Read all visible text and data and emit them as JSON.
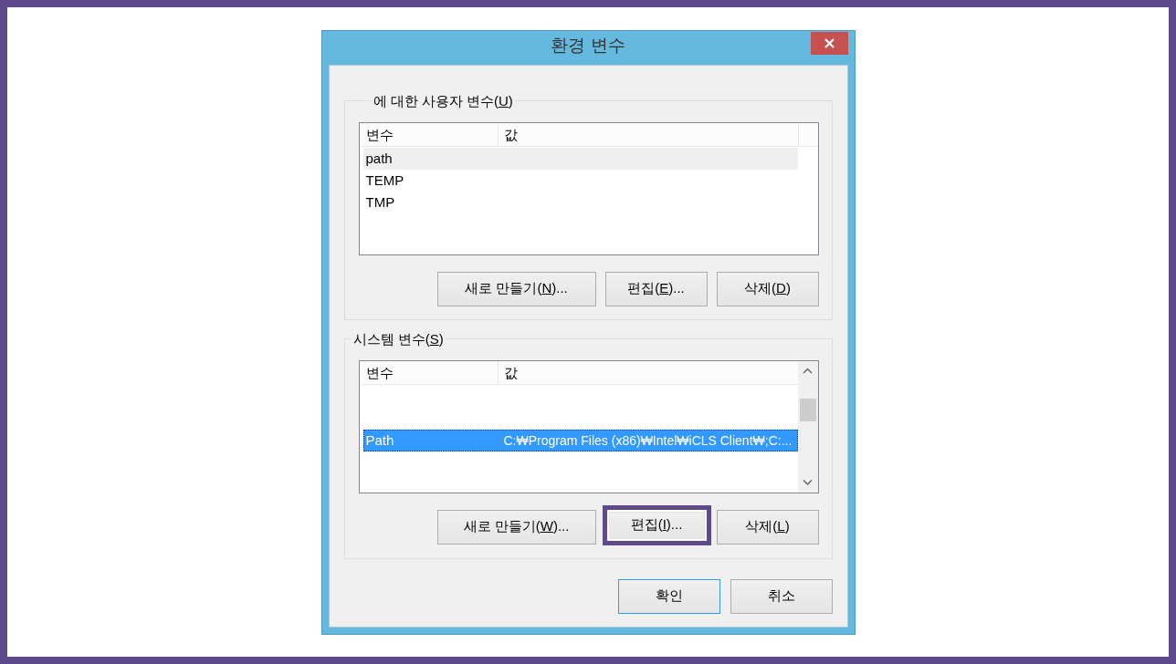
{
  "window": {
    "title": "환경 변수"
  },
  "groups": [
    {
      "legend": {
        "text": "에 대한 사용자 변수(",
        "key": "U",
        "tail": ")"
      },
      "list": {
        "columns": [
          "변수",
          "값"
        ],
        "focused": false,
        "scrollbar": false,
        "rows": [
          {
            "name": "path",
            "selected": true
          },
          {
            "name": "TEMP",
            "selected": false
          },
          {
            "name": "TMP",
            "selected": false
          }
        ]
      },
      "buttons": [
        {
          "label": {
            "text": "새로 만들기(",
            "key": "N",
            "tail": ")..."
          },
          "highlighted": false
        },
        {
          "label": {
            "text": "편집(",
            "key": "E",
            "tail": ")..."
          },
          "highlighted": false
        },
        {
          "label": {
            "text": "삭제(",
            "key": "D",
            "tail": ")"
          },
          "highlighted": false
        }
      ]
    },
    {
      "legend": {
        "text": "시스템 변수(",
        "key": "S",
        "tail": ")"
      },
      "list": {
        "columns": [
          "변수",
          "값"
        ],
        "focused": true,
        "scrollbar": true,
        "rows": [
          {
            "name": "Path",
            "value": "C:₩Program Files (x86)₩Intel₩iCLS Client₩;C:...",
            "selected": true
          }
        ]
      },
      "buttons": [
        {
          "label": {
            "text": "새로 만들기(",
            "key": "W",
            "tail": ")..."
          },
          "highlighted": false
        },
        {
          "label": {
            "text": "편집(",
            "key": "I",
            "tail": ")..."
          },
          "highlighted": true
        },
        {
          "label": {
            "text": "삭제(",
            "key": "L",
            "tail": ")"
          },
          "highlighted": false
        }
      ]
    }
  ],
  "dialog_buttons": [
    {
      "label": {
        "text": "확인"
      },
      "default": true
    },
    {
      "label": {
        "text": "취소"
      },
      "default": false
    }
  ]
}
